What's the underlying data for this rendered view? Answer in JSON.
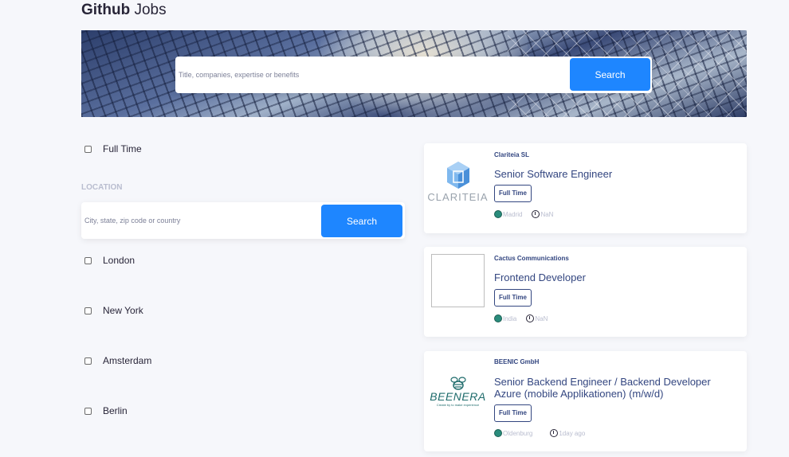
{
  "header": {
    "brand_bold": "Github",
    "brand_rest": "Jobs"
  },
  "hero_search": {
    "placeholder": "Title, companies, expertise or benefits",
    "button_label": "Search"
  },
  "filters": {
    "full_time_label": "Full Time",
    "location_heading": "LOCATION",
    "location_search": {
      "placeholder": "City, state, zip code or country",
      "button_label": "Search"
    },
    "cities": [
      "London",
      "New York",
      "Amsterdam",
      "Berlin"
    ]
  },
  "jobs": [
    {
      "company": "Clariteia SL",
      "title": "Senior Software Engineer",
      "type": "Full Time",
      "location": "Madrid",
      "posted": "NaN",
      "logo": {
        "icon": "clariteia-cube-icon",
        "text": "CLARITEIA",
        "color": "#4a90d9"
      }
    },
    {
      "company": "Cactus Communications",
      "title": "Frontend Developer",
      "type": "Full Time",
      "location": "India",
      "posted": "NaN",
      "logo": {
        "icon": "empty-logo"
      }
    },
    {
      "company": "BEENIC GmbH",
      "title": "Senior Backend Engineer / Backend Developer Azure (mobile Applikationen) (m/w/d)",
      "type": "Full Time",
      "location": "Oldenburg",
      "posted": "1day ago",
      "logo": {
        "icon": "bee-icon",
        "text": "BEENERA",
        "tagline": "Create by to make experience"
      }
    }
  ],
  "colors": {
    "accent": "#1e86ff",
    "primary_text": "#334680",
    "muted": "#b9bdcf",
    "background": "#f6f7fb"
  }
}
